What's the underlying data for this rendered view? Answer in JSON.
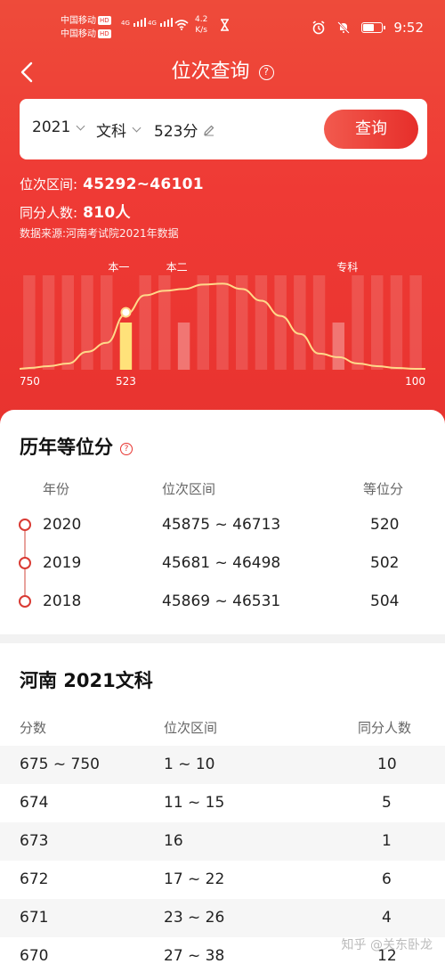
{
  "status": {
    "carrier1": "中国移动",
    "carrier2": "中国移动",
    "hd": "HD",
    "net1": "4G",
    "net2": "4G",
    "speed_value": "4.2",
    "speed_unit": "K/s",
    "time": "9:52",
    "icons": [
      "alarm-icon",
      "mute-icon",
      "battery-icon",
      "wifi-icon",
      "hourglass-icon"
    ]
  },
  "nav": {
    "title": "位次查询",
    "help": "?"
  },
  "query": {
    "year": "2021",
    "subject": "文科",
    "score": "523分",
    "button": "查询"
  },
  "result": {
    "rank_label": "位次区间:",
    "rank_value": "45292~46101",
    "same_label": "同分人数:",
    "same_value": "810人",
    "source": "数据来源:河南考试院2021年数据"
  },
  "chart_data": {
    "type": "area",
    "x_start_label": "750",
    "x_marker_label": "523",
    "x_end_label": "100",
    "x": [
      750,
      100
    ],
    "highlight_score": 523,
    "batch_lines": [
      {
        "label": "本一",
        "bar": 5
      },
      {
        "label": "本二",
        "bar": 8
      },
      {
        "label": "专科",
        "bar": 16
      }
    ],
    "background_bar_count": 21,
    "curve": [
      0.02,
      0.04,
      0.07,
      0.2,
      0.3,
      0.62,
      0.83,
      0.88,
      0.9,
      0.95,
      0.96,
      0.9,
      0.77,
      0.6,
      0.4,
      0.18,
      0.14,
      0.07,
      0.04,
      0.02,
      0.01
    ],
    "colors": {
      "curve": "#ffd98a",
      "highlight": "#ffe27a",
      "bars": "#ffffff"
    }
  },
  "history": {
    "title": "历年等位分",
    "headers": [
      "年份",
      "位次区间",
      "等位分"
    ],
    "rows": [
      {
        "year": "2020",
        "range": "45875 ~ 46713",
        "score": "520"
      },
      {
        "year": "2019",
        "range": "45681 ~ 46498",
        "score": "502"
      },
      {
        "year": "2018",
        "range": "45869 ~ 46531",
        "score": "504"
      }
    ]
  },
  "table": {
    "title": "河南 2021文科",
    "headers": [
      "分数",
      "位次区间",
      "同分人数"
    ],
    "rows": [
      {
        "score": "675 ~ 750",
        "range": "1 ~ 10",
        "count": "10"
      },
      {
        "score": "674",
        "range": "11 ~ 15",
        "count": "5"
      },
      {
        "score": "673",
        "range": "16",
        "count": "1"
      },
      {
        "score": "672",
        "range": "17 ~ 22",
        "count": "6"
      },
      {
        "score": "671",
        "range": "23 ~ 26",
        "count": "4"
      },
      {
        "score": "670",
        "range": "27 ~ 38",
        "count": "12"
      }
    ]
  },
  "watermark": "知乎 @关东卧龙",
  "colors": {
    "brand": "#e8332f",
    "brand_light": "#ee4b3a"
  }
}
